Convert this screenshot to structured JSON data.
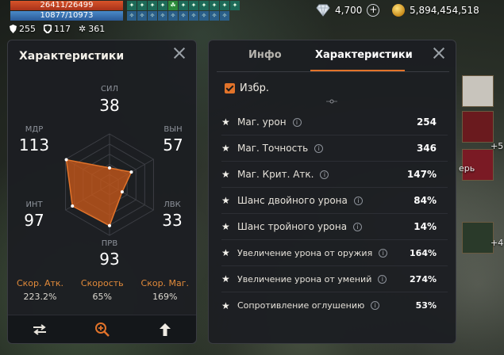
{
  "hud": {
    "hp": "26411/26499",
    "mp": "10877/10973",
    "defense": "255",
    "shield": "117",
    "power": "361",
    "diamonds": "4,700",
    "gold": "5,894,454,518",
    "icons": {
      "defense": "shield-icon",
      "shield": "armor-icon",
      "power": "gear-icon",
      "diamonds": "diamond-icon",
      "gold": "gold-coin-icon"
    }
  },
  "left_panel": {
    "title": "Характеристики",
    "radar": {
      "СИЛ": 38,
      "ВЫН": 57,
      "ЛВК": 33,
      "ПРВ": 93,
      "ИНТ": 97,
      "МДР": 113
    },
    "stats": [
      {
        "label": "СИЛ",
        "value": "38"
      },
      {
        "label": "ВЫН",
        "value": "57"
      },
      {
        "label": "ЛВК",
        "value": "33"
      },
      {
        "label": "ПРВ",
        "value": "93"
      },
      {
        "label": "ИНТ",
        "value": "97"
      },
      {
        "label": "МДР",
        "value": "113"
      }
    ],
    "bottom": [
      {
        "label": "Скор. Атк.",
        "value": "223.2%"
      },
      {
        "label": "Скорость",
        "value": "65%"
      },
      {
        "label": "Скор. Маг.",
        "value": "169%"
      }
    ],
    "footer_icons": [
      "swap-icon",
      "zoom-icon",
      "upload-arrow-icon"
    ]
  },
  "right_panel": {
    "tabs": [
      "Инфо",
      "Характеристики"
    ],
    "active_tab": "Характеристики",
    "favorite_label": "Избр.",
    "favorite_checked": true,
    "rows": [
      {
        "name": "Маг. урон",
        "value": "254"
      },
      {
        "name": "Маг. Точность",
        "value": "346"
      },
      {
        "name": "Маг. Крит. Атк.",
        "value": "147%"
      },
      {
        "name": "Шанс двойного урона",
        "value": "84%"
      },
      {
        "name": "Шанс тройного урона",
        "value": "14%"
      },
      {
        "name": "Увеличение урона от оружия",
        "value": "164%"
      },
      {
        "name": "Увеличение урона от умений",
        "value": "274%"
      },
      {
        "name": "Сопротивление оглушению",
        "value": "53%"
      }
    ]
  },
  "edge": {
    "plus_5": "+5",
    "plus_4": "+4",
    "text_fragment": "ерь"
  },
  "colors": {
    "accent": "#e2732a",
    "panel_bg": "#1c1e22",
    "radar_fill": "#c8581a",
    "hp": "#c8421e",
    "mp": "#3a72b0"
  }
}
